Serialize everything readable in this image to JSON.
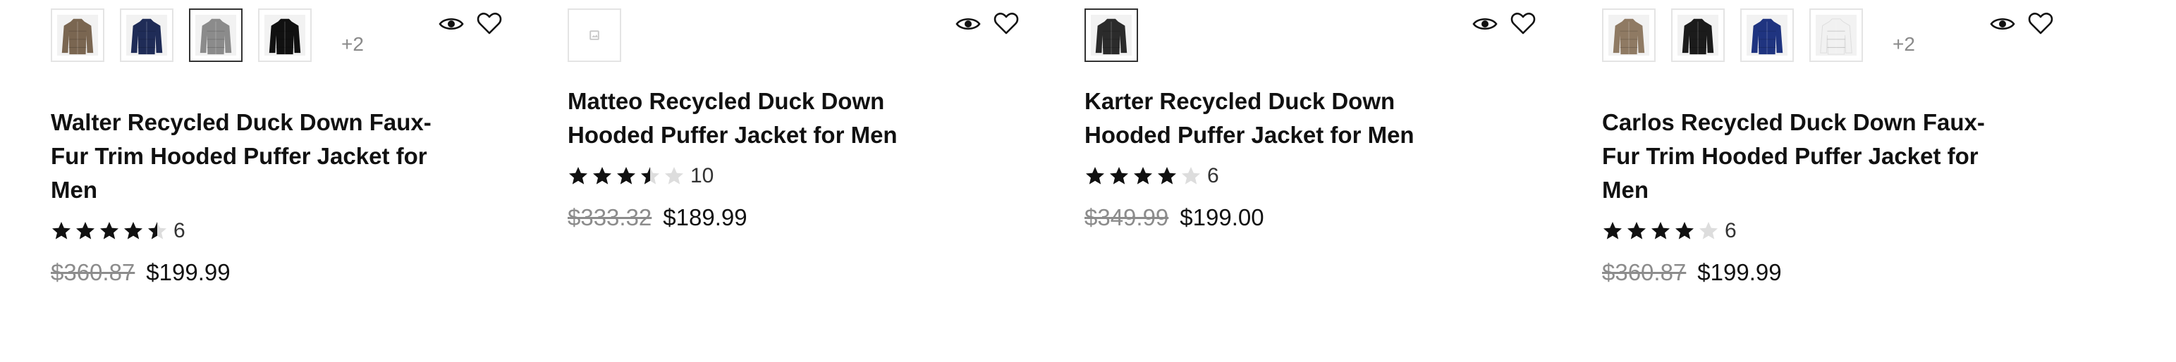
{
  "products": [
    {
      "title": "Walter Recycled Duck Down Faux-Fur Trim Hooded Puffer Jacket for Men",
      "rating": 4.5,
      "review_count": "6",
      "price_original": "$360.87",
      "price_sale": "$199.99",
      "more_colors": "+2",
      "swatches": [
        {
          "color": "#7a6651",
          "icon": "jacket-thumbnail"
        },
        {
          "color": "#1f2c57",
          "icon": "jacket-thumbnail"
        },
        {
          "color": "#8b8b8b",
          "icon": "jacket-thumbnail",
          "selected": true
        },
        {
          "color": "#111111",
          "icon": "jacket-thumbnail"
        }
      ]
    },
    {
      "title": "Matteo Recycled Duck Down Hooded Puffer Jacket for Men",
      "rating": 3.5,
      "review_count": "10",
      "price_original": "$333.32",
      "price_sale": "$189.99",
      "more_colors": "",
      "swatches": [
        {
          "color": "#d8d8d8",
          "icon": "image-placeholder",
          "selected": true
        }
      ]
    },
    {
      "title": "Karter Recycled Duck Down Hooded Puffer Jacket for Men",
      "rating": 4,
      "review_count": "6",
      "price_original": "$349.99",
      "price_sale": "$199.00",
      "more_colors": "",
      "swatches": [
        {
          "color": "#2b2b2b",
          "icon": "jacket-thumbnail",
          "selected": true
        }
      ]
    },
    {
      "title": "Carlos Recycled Duck Down Faux-Fur Trim Hooded Puffer Jacket for Men",
      "rating": 4,
      "review_count": "6",
      "price_original": "$360.87",
      "price_sale": "$199.99",
      "more_colors": "+2",
      "swatches": [
        {
          "color": "#8f7a63",
          "icon": "jacket-thumbnail"
        },
        {
          "color": "#1b1b1b",
          "icon": "jacket-thumbnail"
        },
        {
          "color": "#1f3480",
          "icon": "jacket-thumbnail"
        },
        {
          "color": "#f1f1f1",
          "icon": "jacket-thumbnail"
        }
      ]
    }
  ],
  "icons": {
    "quick_view": "eye-icon",
    "wishlist": "heart-icon",
    "star": "star-icon"
  },
  "colors": {
    "star_filled": "#111111",
    "star_empty": "#dddddd"
  }
}
